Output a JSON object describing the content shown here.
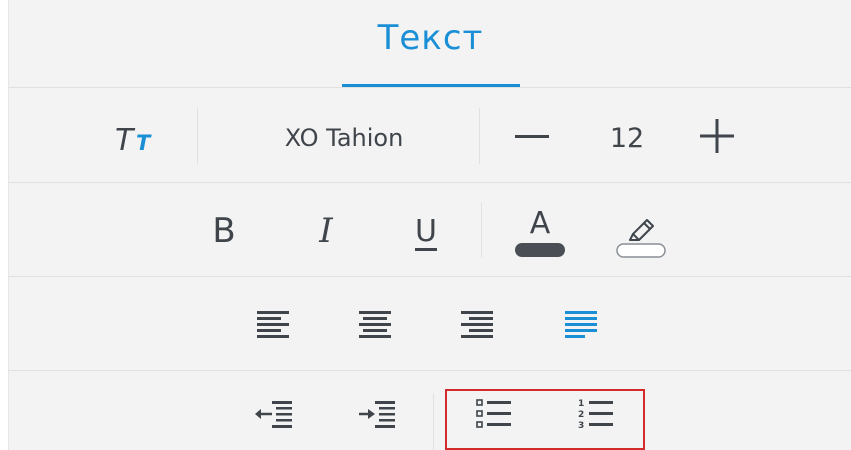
{
  "tabs": {
    "active_label": "Текст"
  },
  "font_row": {
    "style_icon": "text-size-icon",
    "font_name": "XO Tahion",
    "size_decrease_icon": "minus-icon",
    "font_size": "12",
    "size_increase_icon": "plus-icon"
  },
  "format_row": {
    "bold_label": "B",
    "italic_label": "I",
    "underline_label": "U",
    "text_color_letter": "A",
    "text_color": "#4a4f55",
    "highlight_icon": "highlighter-icon"
  },
  "align_row": {
    "items": [
      {
        "name": "align-left",
        "icon": "align-left-icon",
        "active": false
      },
      {
        "name": "align-center",
        "icon": "align-center-icon",
        "active": false
      },
      {
        "name": "align-right",
        "icon": "align-right-icon",
        "active": false
      },
      {
        "name": "align-justify",
        "icon": "align-justify-icon",
        "active": true
      }
    ]
  },
  "list_row": {
    "items": [
      {
        "name": "outdent",
        "icon": "outdent-icon"
      },
      {
        "name": "indent",
        "icon": "indent-icon"
      },
      {
        "name": "bulleted-list",
        "icon": "bulleted-list-icon"
      },
      {
        "name": "numbered-list",
        "icon": "numbered-list-icon"
      }
    ],
    "numbers": [
      "1",
      "2",
      "3"
    ]
  },
  "colors": {
    "accent": "#1a8fd6",
    "icon": "#3f454b",
    "highlight_frame": "#d32a2a"
  }
}
